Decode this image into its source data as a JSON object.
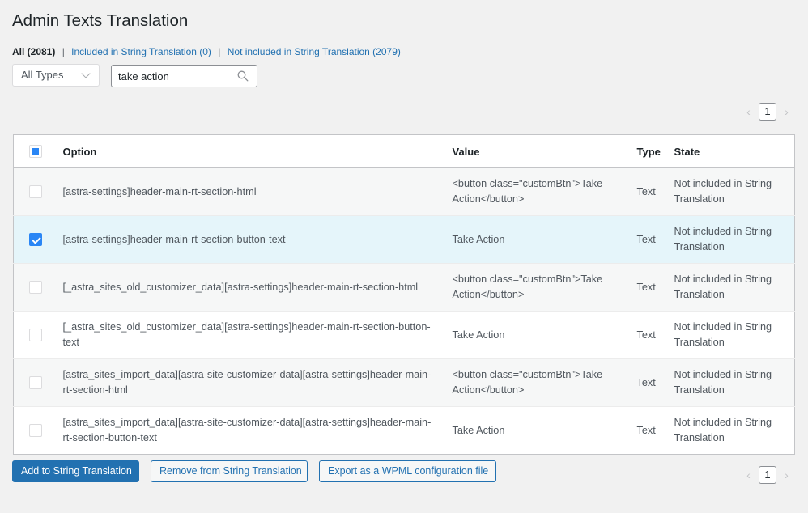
{
  "page": {
    "title": "Admin Texts Translation"
  },
  "filters": {
    "all": "All (2081)",
    "included": "Included in String Translation (0)",
    "not_included": "Not included in String Translation (2079)",
    "separator": "|"
  },
  "type_select": {
    "selected": "All Types"
  },
  "search": {
    "value": "take action",
    "icon": "search-icon"
  },
  "pagination": {
    "current_page": "1",
    "prev_icon": "‹",
    "next_icon": "›"
  },
  "table": {
    "columns": {
      "option": "Option",
      "value": "Value",
      "type": "Type",
      "state": "State"
    },
    "header_checkbox_state": "indeterminate",
    "rows": [
      {
        "checked": false,
        "option": "[astra-settings]header-main-rt-section-html",
        "value": "<button class=\"customBtn\">Take Action</button>",
        "type": "Text",
        "state": "Not included in String Translation"
      },
      {
        "checked": true,
        "option": "[astra-settings]header-main-rt-section-button-text",
        "value": "Take Action",
        "type": "Text",
        "state": "Not included in String Translation"
      },
      {
        "checked": false,
        "option": "[_astra_sites_old_customizer_data][astra-settings]header-main-rt-section-html",
        "value": "<button class=\"customBtn\">Take Action</button>",
        "type": "Text",
        "state": "Not included in String Translation"
      },
      {
        "checked": false,
        "option": "[_astra_sites_old_customizer_data][astra-settings]header-main-rt-section-button-text",
        "value": "Take Action",
        "type": "Text",
        "state": "Not included in String Translation"
      },
      {
        "checked": false,
        "option": "[astra_sites_import_data][astra-site-customizer-data][astra-settings]header-main-rt-section-html",
        "value": "<button class=\"customBtn\">Take Action</button>",
        "type": "Text",
        "state": "Not included in String Translation"
      },
      {
        "checked": false,
        "option": "[astra_sites_import_data][astra-site-customizer-data][astra-settings]header-main-rt-section-button-text",
        "value": "Take Action",
        "type": "Text",
        "state": "Not included in String Translation"
      }
    ]
  },
  "actions": {
    "add": "Add to String Translation",
    "remove": "Remove from String Translation",
    "export": "Export as a WPML configuration file"
  },
  "colors": {
    "accent": "#2271b1",
    "checkbox_blue": "#2a86f5",
    "selected_row": "#e5f5fa"
  }
}
